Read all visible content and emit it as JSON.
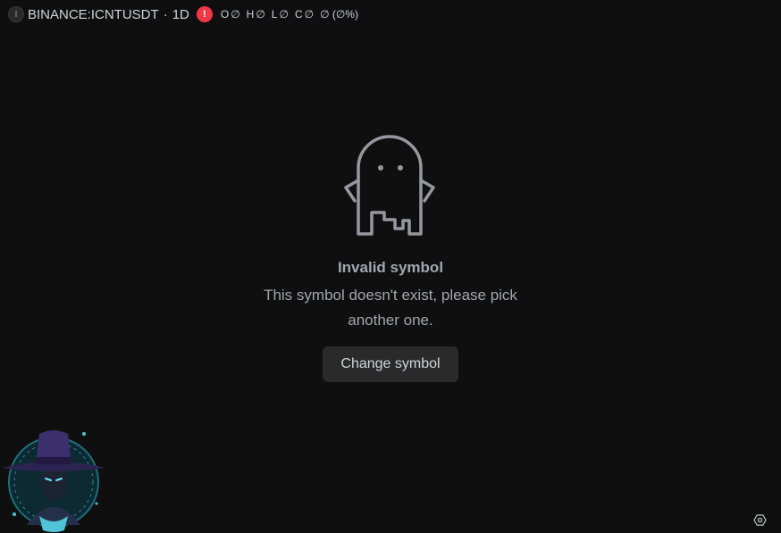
{
  "legend": {
    "logo_letter": "I",
    "symbol": "BINANCE:ICNTUSDT",
    "separator": "·",
    "interval": "1D",
    "warning_glyph": "!",
    "ohlc": [
      {
        "key": "O",
        "value": "∅"
      },
      {
        "key": "H",
        "value": "∅"
      },
      {
        "key": "L",
        "value": "∅"
      },
      {
        "key": "C",
        "value": "∅"
      }
    ],
    "change": "∅ (∅%)"
  },
  "empty_state": {
    "icon": "ghost-icon",
    "title": "Invalid symbol",
    "message": "This symbol doesn't exist, please pick another one.",
    "button_label": "Change symbol"
  },
  "widgets": {
    "brand_logo": "wizard-hat-logo",
    "settings_icon": "gear-icon"
  },
  "colors": {
    "background": "#0f0f0f",
    "text": "#d1d4dc",
    "muted_text": "#a3a6af",
    "warning": "#f23645",
    "button_bg": "#2a2a2a"
  }
}
